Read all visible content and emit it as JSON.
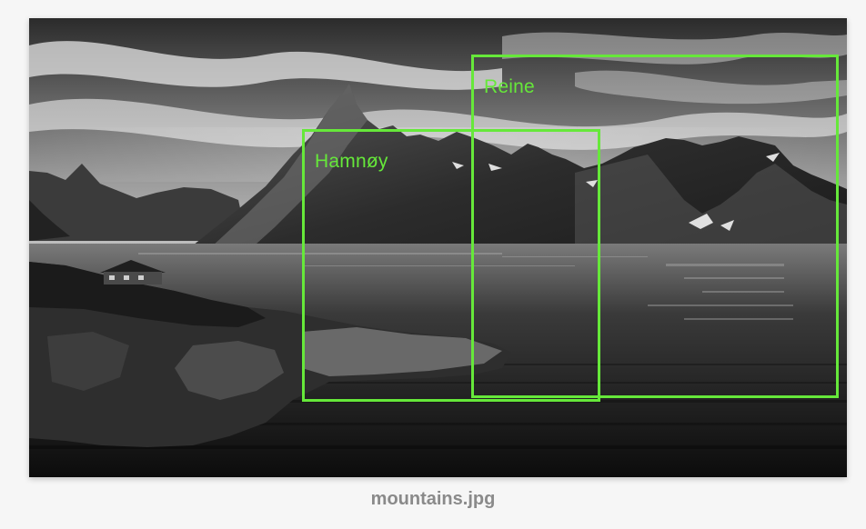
{
  "image": {
    "filename": "mountains.jpg",
    "icon": "photo-icon"
  },
  "annotations": [
    {
      "label": "Reine"
    },
    {
      "label": "Hamnøy"
    }
  ],
  "colors": {
    "box_stroke": "#66e83a",
    "label_text": "#66e83a",
    "caption_text": "#8a8a8a",
    "page_background": "#f6f6f6"
  }
}
